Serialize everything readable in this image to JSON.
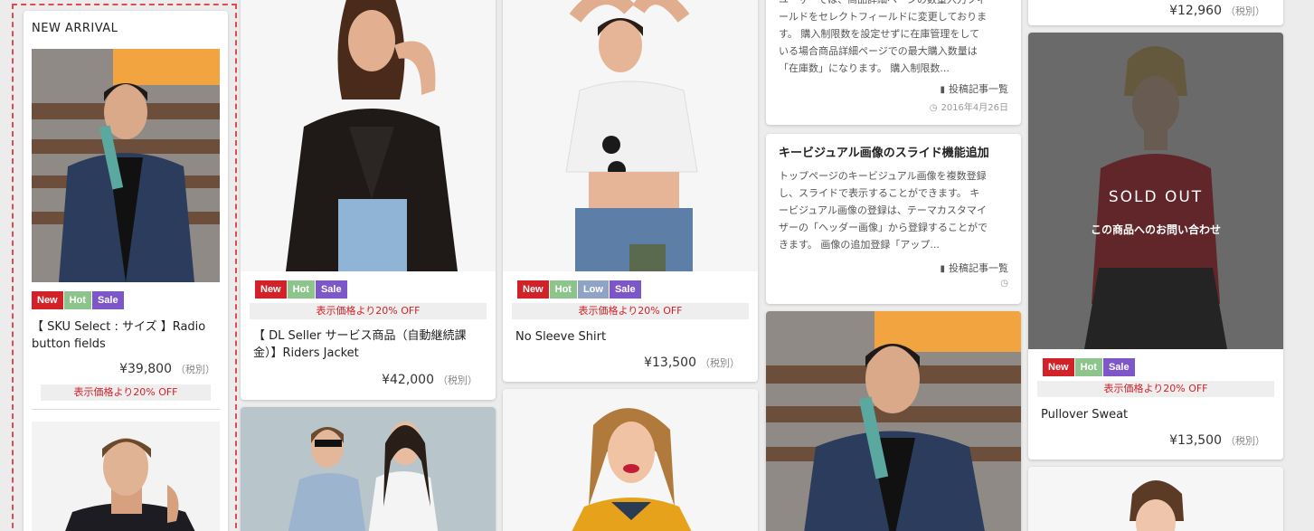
{
  "colors": {
    "new": "#d22228",
    "hot": "#8cc48c",
    "low": "#8fa4c4",
    "sale": "#7d56c8",
    "discount_text": "#d22228",
    "dashed_border": "#e04a55"
  },
  "new_arrival": {
    "heading": "NEW ARRIVAL",
    "item": {
      "badges": [
        "New",
        "Hot",
        "Sale"
      ],
      "name": "【 SKU Select : サイズ 】Radio button fields",
      "price": "¥39,800",
      "tax": "（税別）",
      "discount": "表示価格より20% OFF"
    }
  },
  "products": {
    "riders_jacket": {
      "badges": [
        "New",
        "Hot",
        "Sale"
      ],
      "discount": "表示価格より20% OFF",
      "name": "【 DL Seller サービス商品（自動継続課金）】Riders Jacket",
      "price": "¥42,000",
      "tax": "（税別）"
    },
    "no_sleeve_shirt": {
      "badges": [
        "New",
        "Hot",
        "Low",
        "Sale"
      ],
      "discount": "表示価格より20% OFF",
      "name": "No Sleeve Shirt",
      "price": "¥13,500",
      "tax": "（税別）"
    },
    "top_right_price": {
      "price": "¥12,960",
      "tax": "（税別）"
    },
    "pullover_sweat": {
      "sold_out": "SOLD OUT",
      "inquiry": "この商品へのお問い合わせ",
      "badges": [
        "New",
        "Hot",
        "Sale"
      ],
      "discount": "表示価格より20% OFF",
      "name": "Pullover Sweat",
      "price": "¥13,500",
      "tax": "（税別）"
    }
  },
  "posts": {
    "post1": {
      "lines": [
        "ユーザーでは、商品詳細ページの数量入力フィ",
        "ールドをセレクトフィールドに変更しておりま",
        "す。 購入制限数を設定せずに在庫管理をして",
        "いる場合商品詳細ページでの最大購入数量は",
        "「在庫数」になります。 購入制限数..."
      ],
      "link": "投稿記事一覧",
      "date": "2016年4月26日"
    },
    "post2": {
      "title": "キービジュアル画像のスライド機能追加",
      "lines": [
        "トップページのキービジュアル画像を複数登録",
        "し、スライドで表示することができます。 キ",
        "ービジュアル画像の登録は、テーマカスタマイ",
        "ザーの「ヘッダー画像」から登録することがで",
        "きます。 画像の追加登録「アップ..."
      ],
      "link": "投稿記事一覧",
      "date": ""
    }
  }
}
